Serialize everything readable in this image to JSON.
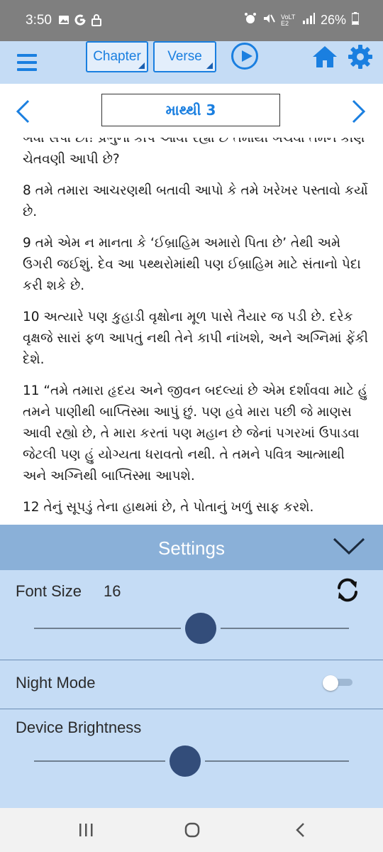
{
  "status_bar": {
    "time": "3:50",
    "left_icons": [
      "image-icon",
      "google-icon",
      "lock-icon"
    ],
    "network": "VoLTE2",
    "battery": "26%"
  },
  "toolbar": {
    "chapter_label": "Chapter",
    "verse_label": "Verse"
  },
  "chapter_nav": {
    "title": "માથ્થી 3"
  },
  "content": {
    "verses": [
      "બધા સપો છો! પ્રભુના કોપ આવી રહ્યો છે તમોથી બચવા તમને કોણે ચેતવણી આપી છે?",
      "8  તમે તમારા આચરણથી બતાવી આપો કે તમે ખરેખર પસ્તાવો કર્યો છે.",
      "9  તમે એમ ન માનતા કે ‘ઈબ્રાહિમ અમારો પિતા છે’ તેથી અમે ઉગરી જઈશું. દેવ આ પથ્થરોમાંથી પણ ઈબ્રાહિમ માટે સંતાનો પેદા કરી શકે છે.",
      "10  અત્યારે પણ કુહાડી વૃક્ષોના મૂળ પાસે તૈયાર જ પડી છે. દરેક વૃક્ષજે સારાં ફળ આપતું નથી તેને કાપી નાંખશે, અને અગ્નિમાં ફેંકી દેશે.",
      "11  “તમે તમારા હૃદય અને જીવન બદલ્યાં છે એમ દર્શાવવા માટે હું તમને પાણીથી બાપ્તિસ્મા આપું છું. પણ હવે મારા પછી જે માણસ આવી રહ્યો છે, તે મારા કરતાં પણ મહાન છે જેનાં પગરખાં ઉપાડવા જેટલી પણ હું યોગ્યતા ધરાવતો નથી. તે તમને પવિત્ર આત્માથી અને અગ્નિથી બાપ્તિસ્મા આપશે.",
      "12  તેનું સૂપડું તેના હાથમાં છે, તે પોતાનું ખળું સાફ કરશે."
    ]
  },
  "settings": {
    "title": "Settings",
    "font_size_label": "Font Size",
    "font_size_value": "16",
    "font_size_level": 0.53,
    "night_mode_label": "Night Mode",
    "night_mode_on": false,
    "brightness_label": "Device Brightness",
    "brightness_level": 0.48
  },
  "colors": {
    "accent": "#1a7fe0",
    "toolbar_bg": "#c5dcf5",
    "settings_header_bg": "#8ab0d8",
    "slider_thumb": "#334d7a"
  }
}
